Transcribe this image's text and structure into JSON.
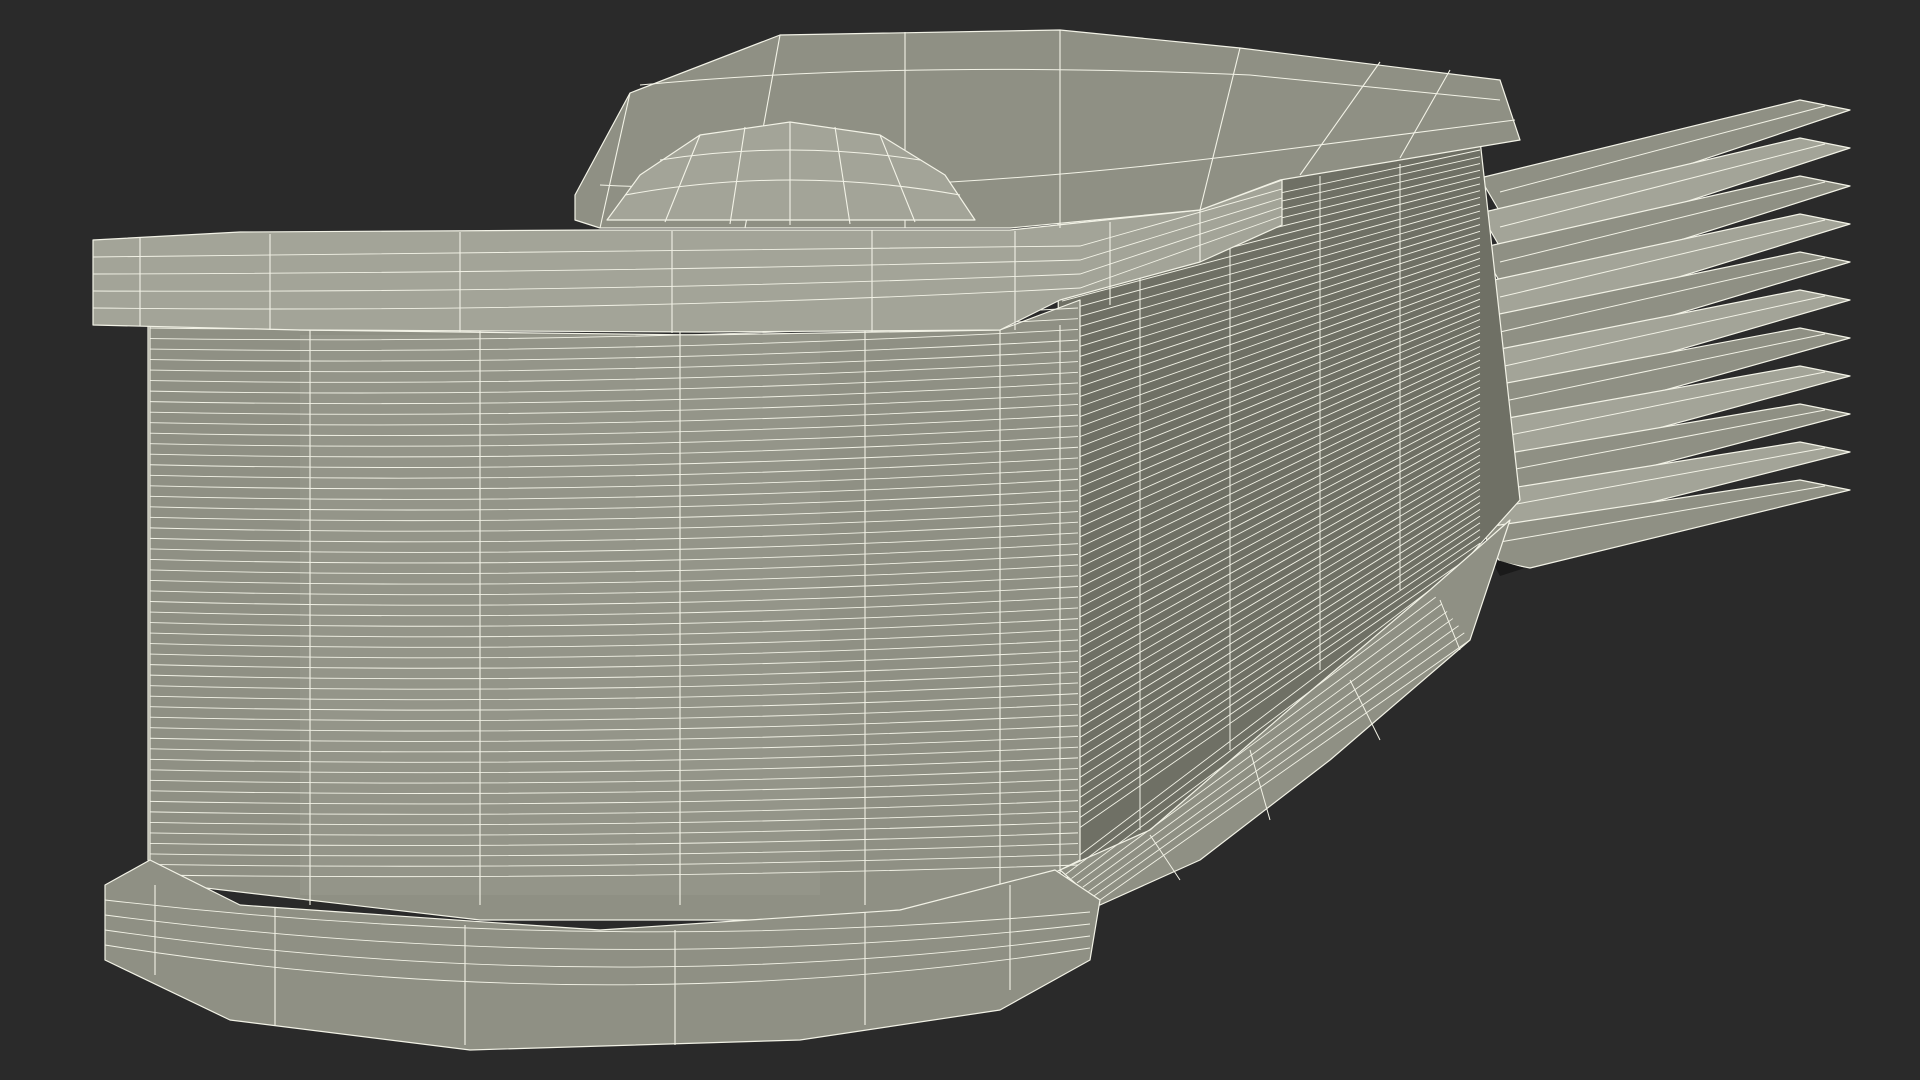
{
  "scene": {
    "background_color": "#2a2a2a",
    "surface_color": "#8f9084",
    "surface_shade_color": "#6f7065",
    "surface_light_color": "#a3a498",
    "wire_color": "#f2f2e6",
    "gap_color": "#1a1a1a"
  }
}
